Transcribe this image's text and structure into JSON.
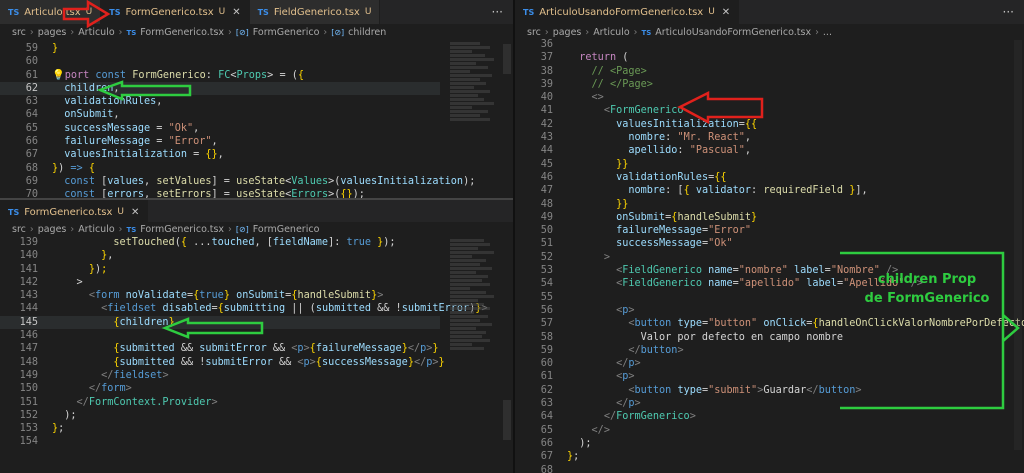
{
  "left_top": {
    "tabs": [
      {
        "label": "Articulo.tsx",
        "badge": "U",
        "active": false
      },
      {
        "label": "FormGenerico.tsx",
        "badge": "U",
        "active": true
      },
      {
        "label": "FieldGenerico.tsx",
        "badge": "U",
        "active": false
      }
    ],
    "ts_badge": "TS",
    "more": "···",
    "breadcrumb": [
      "src",
      "pages",
      "Articulo",
      "FormGenerico.tsx",
      "FormGenerico",
      "children"
    ],
    "lines": [
      {
        "n": "59",
        "html": "<span class='br'>}</span>"
      },
      {
        "n": "60",
        "html": ""
      },
      {
        "n": "61",
        "html": "<span class='br'>💡</span><span class='c'>port</span> <span class='k'>const</span> <span class='f'>FormGenerico</span>: <span class='t'>FC</span>&lt;<span class='t'>Props</span>&gt; = (<span class='br'>{</span>"
      },
      {
        "n": "62",
        "html": "  <span class='v'>children</span>,"
      },
      {
        "n": "63",
        "html": "  <span class='v'>validationRules</span>,"
      },
      {
        "n": "64",
        "html": "  <span class='v'>onSubmit</span>,"
      },
      {
        "n": "65",
        "html": "  <span class='v'>successMessage</span> = <span class='s'>\"Ok\"</span>,"
      },
      {
        "n": "66",
        "html": "  <span class='v'>failureMessage</span> = <span class='s'>\"Error\"</span>,"
      },
      {
        "n": "67",
        "html": "  <span class='v'>valuesInitialization</span> = <span class='br'>{}</span>,"
      },
      {
        "n": "68",
        "html": "<span class='br'>}</span>) <span class='k'>=&gt;</span> <span class='br'>{</span>"
      },
      {
        "n": "69",
        "html": "  <span class='k'>const</span> [<span class='v'>values</span>, <span class='f'>setValues</span>] = <span class='f'>useState</span>&lt;<span class='t'>Values</span>&gt;(<span class='v'>valuesInitialization</span>);"
      },
      {
        "n": "70",
        "html": "  <span class='k'>const</span> [<span class='v'>errors</span>, <span class='f'>setErrors</span>] = <span class='f'>useState</span>&lt;<span class='t'>Errors</span>&gt;(<span class='br'>{}</span>);"
      }
    ]
  },
  "left_bottom": {
    "tabs": [
      {
        "label": "FormGenerico.tsx",
        "badge": "U",
        "active": true
      }
    ],
    "breadcrumb": [
      "src",
      "pages",
      "Articulo",
      "FormGenerico.tsx",
      "FormGenerico"
    ],
    "lines": [
      {
        "n": "139",
        "html": "          <span class='f'>setTouched</span>(<span class='br'>{</span> ...<span class='v'>touched</span>, [<span class='v'>fieldName</span>]: <span class='k'>true</span> <span class='br'>}</span>);"
      },
      {
        "n": "140",
        "html": "        <span class='br'>}</span>,"
      },
      {
        "n": "141",
        "html": "      <span class='br'>}</span>)<span class='br'>;</span>"
      },
      {
        "n": "142",
        "html": "    &gt;"
      },
      {
        "n": "143",
        "html": "      <span class='p'>&lt;</span><span class='k'>form</span> <span class='v'>noValidate</span>=<span class='br'>{</span><span class='k'>true</span><span class='br'>}</span> <span class='v'>onSubmit</span>=<span class='br'>{</span><span class='f'>handleSubmit</span><span class='br'>}</span><span class='p'>&gt;</span>"
      },
      {
        "n": "144",
        "html": "        <span class='p'>&lt;</span><span class='k'>fieldset</span> <span class='v'>disabled</span>=<span class='br'>{</span><span class='v'>submitting</span> || (<span class='v'>submitted</span> &amp;&amp; !<span class='v'>submitError</span>)<span class='br'>}</span><span class='p'>&gt;</span>"
      },
      {
        "n": "145",
        "html": "          <span class='br'>{</span><span class='v'>children</span><span class='br'>}</span>"
      },
      {
        "n": "146",
        "html": ""
      },
      {
        "n": "147",
        "html": "          <span class='br'>{</span><span class='v'>submitted</span> &amp;&amp; <span class='v'>submitError</span> &amp;&amp; <span class='p'>&lt;</span><span class='k'>p</span><span class='p'>&gt;</span><span class='br'>{</span><span class='v'>failureMessage</span><span class='br'>}</span><span class='p'>&lt;/</span><span class='k'>p</span><span class='p'>&gt;</span><span class='br'>}</span>"
      },
      {
        "n": "148",
        "html": "          <span class='br'>{</span><span class='v'>submitted</span> &amp;&amp; !<span class='v'>submitError</span> &amp;&amp; <span class='p'>&lt;</span><span class='k'>p</span><span class='p'>&gt;</span><span class='br'>{</span><span class='v'>successMessage</span><span class='br'>}</span><span class='p'>&lt;/</span><span class='k'>p</span><span class='p'>&gt;</span><span class='br'>}</span>"
      },
      {
        "n": "149",
        "html": "        <span class='p'>&lt;/</span><span class='k'>fieldset</span><span class='p'>&gt;</span>"
      },
      {
        "n": "150",
        "html": "      <span class='p'>&lt;/</span><span class='k'>form</span><span class='p'>&gt;</span>"
      },
      {
        "n": "151",
        "html": "    <span class='p'>&lt;/</span><span class='t'>FormContext.Provider</span><span class='p'>&gt;</span>"
      },
      {
        "n": "152",
        "html": "  );"
      },
      {
        "n": "153",
        "html": "<span class='br'>}</span>;"
      },
      {
        "n": "154",
        "html": ""
      }
    ]
  },
  "right": {
    "tabs": [
      {
        "label": "ArticuloUsandoFormGenerico.tsx",
        "badge": "U",
        "active": true
      }
    ],
    "more": "···",
    "breadcrumb": [
      "src",
      "pages",
      "Articulo",
      "ArticuloUsandoFormGenerico.tsx",
      "..."
    ],
    "lines": [
      {
        "n": "36",
        "html": ""
      },
      {
        "n": "37",
        "html": "  <span class='c'>return</span> ("
      },
      {
        "n": "38",
        "html": "    <span class='g'>// &lt;Page&gt;</span>"
      },
      {
        "n": "39",
        "html": "    <span class='g'>// &lt;/Page&gt;</span>"
      },
      {
        "n": "40",
        "html": "    <span class='p'>&lt;&gt;</span>"
      },
      {
        "n": "41",
        "html": "      <span class='p'>&lt;</span><span class='tg'>FormGenerico</span>"
      },
      {
        "n": "42",
        "html": "        <span class='v'>valuesInitialization</span>=<span class='br'>{{</span>"
      },
      {
        "n": "43",
        "html": "          <span class='v'>nombre</span>: <span class='s'>\"Mr. React\"</span>,"
      },
      {
        "n": "44",
        "html": "          <span class='v'>apellido</span>: <span class='s'>\"Pascual\"</span>,"
      },
      {
        "n": "45",
        "html": "        <span class='br'>}}</span>"
      },
      {
        "n": "46",
        "html": "        <span class='v'>validationRules</span>=<span class='br'>{{</span>"
      },
      {
        "n": "47",
        "html": "          <span class='v'>nombre</span>: [<span class='br'>{</span> <span class='v'>validator</span>: <span class='f'>requiredField</span> <span class='br'>}</span>],"
      },
      {
        "n": "48",
        "html": "        <span class='br'>}}</span>"
      },
      {
        "n": "49",
        "html": "        <span class='v'>onSubmit</span>=<span class='br'>{</span><span class='f'>handleSubmit</span><span class='br'>}</span>"
      },
      {
        "n": "50",
        "html": "        <span class='v'>failureMessage</span>=<span class='s'>\"Error\"</span>"
      },
      {
        "n": "51",
        "html": "        <span class='v'>successMessage</span>=<span class='s'>\"Ok\"</span>"
      },
      {
        "n": "52",
        "html": "      <span class='p'>&gt;</span>"
      },
      {
        "n": "53",
        "html": "        <span class='p'>&lt;</span><span class='tg'>FieldGenerico</span> <span class='v'>name</span>=<span class='s'>\"nombre\"</span> <span class='v'>label</span>=<span class='s'>\"Nombre\"</span> <span class='p'>/&gt;</span>"
      },
      {
        "n": "54",
        "html": "        <span class='p'>&lt;</span><span class='tg'>FieldGenerico</span> <span class='v'>name</span>=<span class='s'>\"apellido\"</span> <span class='v'>label</span>=<span class='s'>\"Apellido\"</span> <span class='p'>/&gt;</span>"
      },
      {
        "n": "55",
        "html": ""
      },
      {
        "n": "56",
        "html": "        <span class='p'>&lt;</span><span class='k'>p</span><span class='p'>&gt;</span>"
      },
      {
        "n": "57",
        "html": "          <span class='p'>&lt;</span><span class='k'>button</span> <span class='v'>type</span>=<span class='s'>\"button\"</span> <span class='v'>onClick</span>=<span class='br'>{</span><span class='f'>handleOnClickValorNombrePorDefecto</span><span class='br'>}</span><span class='p'>&gt;</span>"
      },
      {
        "n": "58",
        "html": "            Valor por defecto en campo nombre"
      },
      {
        "n": "59",
        "html": "          <span class='p'>&lt;/</span><span class='k'>button</span><span class='p'>&gt;</span>"
      },
      {
        "n": "60",
        "html": "        <span class='p'>&lt;/</span><span class='k'>p</span><span class='p'>&gt;</span>"
      },
      {
        "n": "61",
        "html": "        <span class='p'>&lt;</span><span class='k'>p</span><span class='p'>&gt;</span>"
      },
      {
        "n": "62",
        "html": "          <span class='p'>&lt;</span><span class='k'>button</span> <span class='v'>type</span>=<span class='s'>\"submit\"</span><span class='p'>&gt;</span>Guardar<span class='p'>&lt;/</span><span class='k'>button</span><span class='p'>&gt;</span>"
      },
      {
        "n": "63",
        "html": "        <span class='p'>&lt;/</span><span class='k'>p</span><span class='p'>&gt;</span>"
      },
      {
        "n": "64",
        "html": "      <span class='p'>&lt;/</span><span class='tg'>FormGenerico</span><span class='p'>&gt;</span>"
      },
      {
        "n": "65",
        "html": "    <span class='p'>&lt;/&gt;</span>"
      },
      {
        "n": "66",
        "html": "  );"
      },
      {
        "n": "67",
        "html": "<span class='br'>}</span>;"
      },
      {
        "n": "68",
        "html": ""
      }
    ]
  },
  "annotation": {
    "line1": "children Prop",
    "line2": "de FormGenerico"
  },
  "colors": {
    "red_arrow": "#e0211c",
    "green_arrow": "#2ecc40"
  }
}
